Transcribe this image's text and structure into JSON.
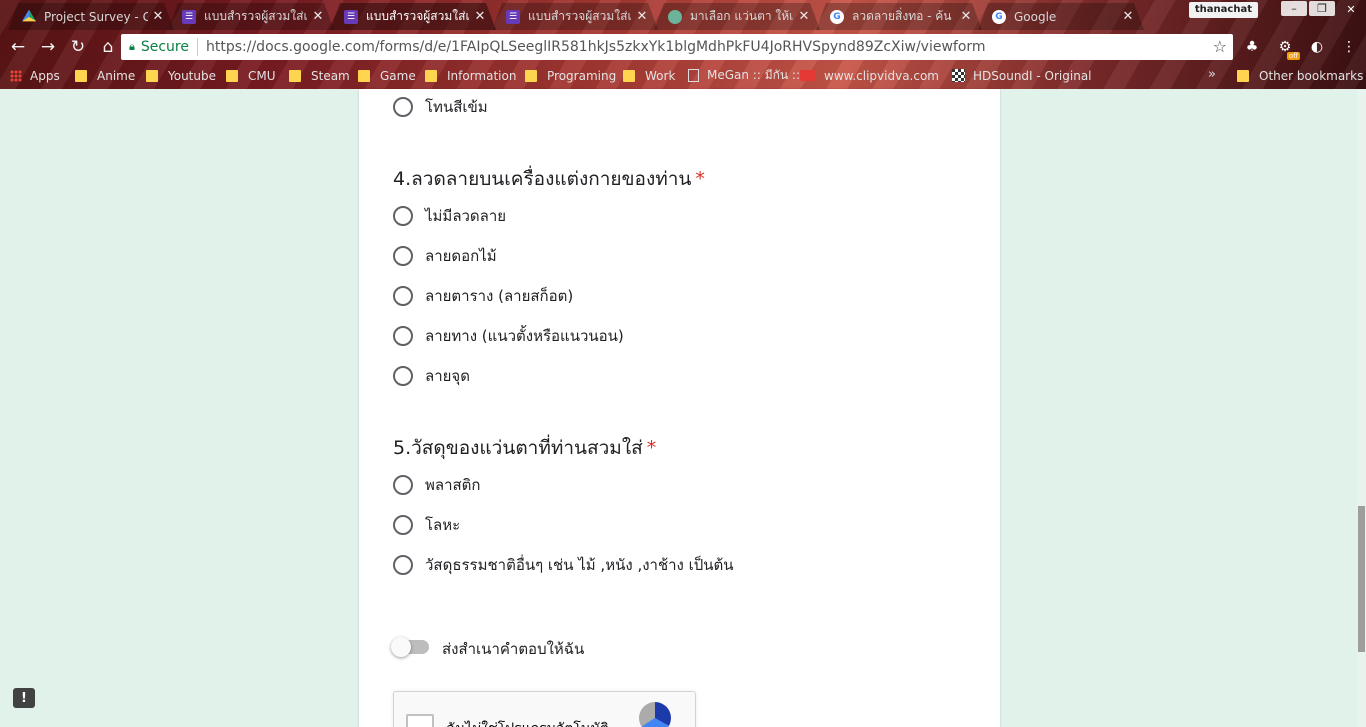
{
  "browser": {
    "tabs": [
      {
        "title": "Project Survey - Go",
        "favicon": "drive-icon",
        "active": false
      },
      {
        "title": "แบบสำรวจผู้สวมใส่แว่",
        "favicon": "forms-icon",
        "active": false
      },
      {
        "title": "แบบสำรวจผู้สวมใส่แว่",
        "favicon": "forms-icon",
        "active": true
      },
      {
        "title": "แบบสำรวจผู้สวมใส่แว่",
        "favicon": "forms-icon",
        "active": false
      },
      {
        "title": "มาเลือก แว่นตา ให้เหม",
        "favicon": "leaf-icon",
        "active": false
      },
      {
        "title": "ลวดลายสิ่งทอ - ค้น",
        "favicon": "google-icon",
        "active": false
      },
      {
        "title": "Google",
        "favicon": "google-icon",
        "active": false
      }
    ],
    "profile_name": "thanachat",
    "secure_label": "Secure",
    "url": "https://docs.google.com/forms/d/e/1FAIpQLSeeglIR581hkJs5zkxYk1blgMdhPkFU4JoRHVSpynd89ZcXiw/viewform",
    "bookmarks": [
      {
        "label": "Apps",
        "icon": "apps-grid-icon"
      },
      {
        "label": "Anime",
        "icon": "folder-icon"
      },
      {
        "label": "Youtube",
        "icon": "folder-icon"
      },
      {
        "label": "CMU",
        "icon": "folder-icon"
      },
      {
        "label": "Steam",
        "icon": "folder-icon"
      },
      {
        "label": "Game",
        "icon": "folder-icon"
      },
      {
        "label": "Information",
        "icon": "folder-icon"
      },
      {
        "label": "Programing",
        "icon": "folder-icon"
      },
      {
        "label": "Work",
        "icon": "folder-icon"
      },
      {
        "label": "MeGan :: มีกัน ::",
        "icon": "page-icon"
      },
      {
        "label": "www.clipvidva.com",
        "icon": "video-icon"
      },
      {
        "label": "HDSoundI - Original",
        "icon": "checker-icon"
      }
    ],
    "more_bookmarks": "»",
    "other_bookmarks": "Other bookmarks"
  },
  "form": {
    "prev_option": "โทนสีเข้ม",
    "q4": {
      "title": "4.ลวดลายบนเครื่องแต่งกายของท่าน",
      "required_mark": "*",
      "options": [
        "ไม่มีลวดลาย",
        "ลายดอกไม้",
        "ลายตาราง (ลายสก็อต)",
        "ลายทาง (แนวตั้งหรือแนวนอน)",
        "ลายจุด"
      ]
    },
    "q5": {
      "title": "5.วัสดุของแว่นตาที่ท่านสวมใส่",
      "required_mark": "*",
      "options": [
        "พลาสติก",
        "โลหะ",
        "วัสดุธรรมชาติอื่นๆ เช่น ไม้ ,หนัง ,งาช้าง เป็นต้น"
      ]
    },
    "send_copy_label": "ส่งสำเนาคำตอบให้ฉัน",
    "send_copy_on": false,
    "recaptcha_label": "ฉันไม่ใช่โปรแกรมอัตโนมัติ"
  },
  "colors": {
    "page_background": "#e0f2ea",
    "required": "#d93025"
  }
}
